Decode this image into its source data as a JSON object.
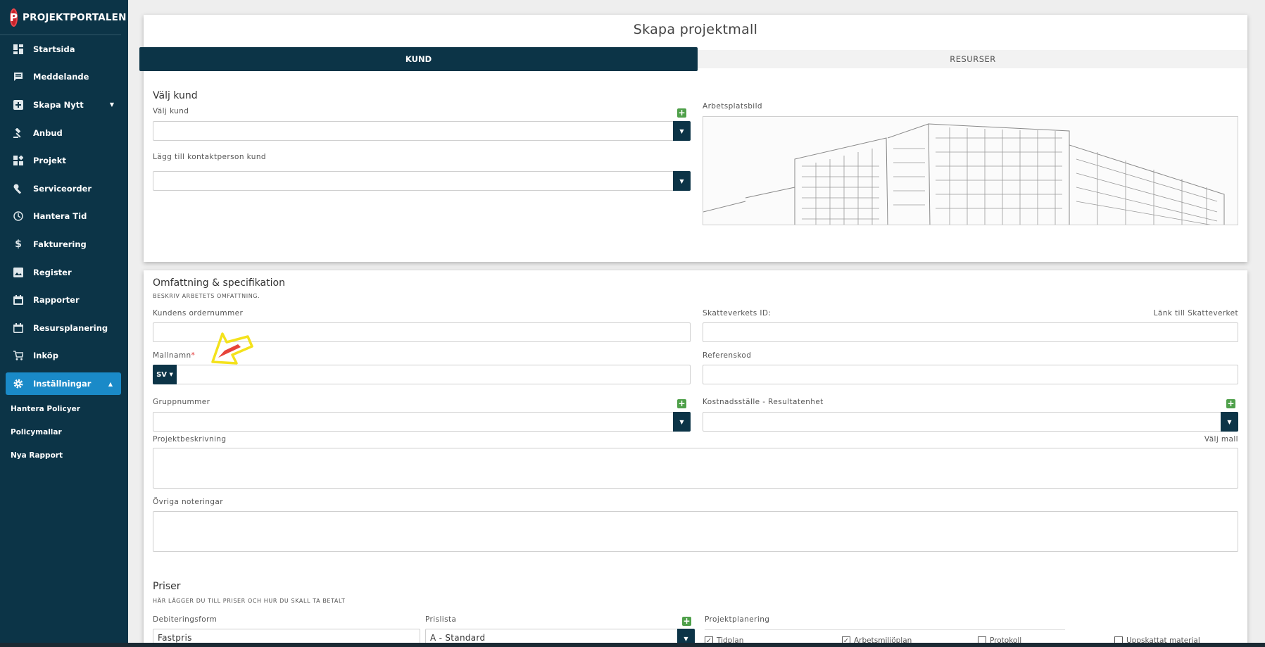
{
  "brand": {
    "name": "PROJEKTPORTALEN",
    "logo_letter": "P"
  },
  "sidebar": {
    "items": [
      {
        "label": "Startsida",
        "icon": "dashboard-icon"
      },
      {
        "label": "Meddelande",
        "icon": "message-icon"
      },
      {
        "label": "Skapa Nytt",
        "icon": "add-box-icon",
        "caret": "▼"
      },
      {
        "label": "Anbud",
        "icon": "gavel-icon"
      },
      {
        "label": "Projekt",
        "icon": "widgets-icon"
      },
      {
        "label": "Serviceorder",
        "icon": "wrench-icon"
      },
      {
        "label": "Hantera Tid",
        "icon": "clock-icon"
      },
      {
        "label": "Fakturering",
        "icon": "dollar-icon"
      },
      {
        "label": "Register",
        "icon": "image-icon"
      },
      {
        "label": "Rapporter",
        "icon": "calendar-icon"
      },
      {
        "label": "Resursplanering",
        "icon": "calendar-blank-icon"
      },
      {
        "label": "Inköp",
        "icon": "cart-icon"
      },
      {
        "label": "Inställningar",
        "icon": "gear-icon",
        "caret": "▲"
      }
    ],
    "sub_items": [
      "Hantera Policyer",
      "Policymallar",
      "Nya Rapport"
    ]
  },
  "page": {
    "title": "Skapa projektmall"
  },
  "tabs": {
    "kund": "KUND",
    "resurser": "RESURSER"
  },
  "kund": {
    "section_title": "Välj kund",
    "valj_kund_label": "Välj kund",
    "kontakt_label": "Lägg till kontaktperson kund",
    "image_label": "Arbetsplatsbild"
  },
  "omfattning": {
    "section_title": "Omfattning & specifikation",
    "section_sub": "BESKRIV ARBETETS OMFATTNING.",
    "ordernummer_label": "Kundens ordernummer",
    "skatteverket_label": "Skatteverkets ID:",
    "skatteverket_link": "Länk till Skatteverket",
    "mallnamn_label": "Mallnamn",
    "mallnamn_req": "*",
    "lang": "SV",
    "referenskod_label": "Referenskod",
    "gruppnummer_label": "Gruppnummer",
    "kostnad_label": "Kostnadsställe - Resultatenhet",
    "beskrivning_label": "Projektbeskrivning",
    "valj_mall": "Välj mall",
    "noteringar_label": "Övriga noteringar"
  },
  "priser": {
    "section_title": "Priser",
    "section_sub": "HÄR LÄGGER DU TILL PRISER OCH HUR DU SKALL TA BETALT",
    "debitering_label": "Debiteringsform",
    "debitering_value": "Fastpris",
    "prislista_label": "Prislista",
    "prislista_value": "A - Standard",
    "planering_label": "Projektplanering",
    "checks": [
      "Tidplan",
      "Arbetsmiljöplan",
      "Protokoll",
      "Uppskattat material"
    ]
  },
  "colors": {
    "sidebar": "#0c3447",
    "active": "#1a8ac8",
    "accent_green": "#4fa04a"
  }
}
